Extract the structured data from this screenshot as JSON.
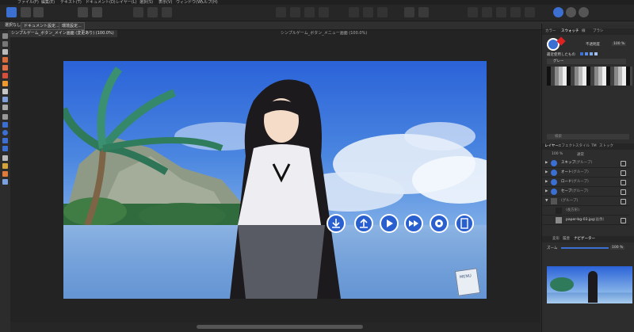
{
  "menubar": {
    "items": [
      "ファイル(F)",
      "編集(E)",
      "テキスト(T)",
      "ドキュメント(D)",
      "レイヤー(L)",
      "選択(S)",
      "表示(V)",
      "ウィンドウ(W)",
      "ヘルプ(H)"
    ]
  },
  "context_toolbar": {
    "deselect_label": "選択なし",
    "document_setup_label": "ドキュメント設定...",
    "preferences_label": "環境設定..."
  },
  "tabs": [
    {
      "label": "シンプルゲーム_ボタン_メイン画面 (変更あり) (100.0%)",
      "active": true
    },
    {
      "label": "シンプルゲーム_ボタン_メニュー画面 (100.0%)",
      "active": false
    }
  ],
  "right_panel": {
    "top_tabs": [
      "カラー",
      "スウォッチ",
      "線",
      "ブラシ"
    ],
    "active_top_tab": "スウォッチ",
    "opacity_label": "不透明度",
    "opacity_value": "100 %",
    "recent_label": "最近使用したもの",
    "palette_name": "グレー",
    "search_placeholder": "検索",
    "layer_tabs": [
      "レイヤー",
      "エフェクト",
      "スタイル",
      "TM",
      "ストック"
    ],
    "active_layer_tab": "レイヤー",
    "opacity_field": "100 %",
    "blend_mode": "通常",
    "layers": [
      {
        "name": "スキップ",
        "type": "(グループ)",
        "icon": "skip-icon"
      },
      {
        "name": "オート",
        "type": "(グループ)",
        "icon": "auto-icon"
      },
      {
        "name": "ロード",
        "type": "(グループ)",
        "icon": "load-icon"
      },
      {
        "name": "セーブ",
        "type": "(グループ)",
        "icon": "save-icon"
      },
      {
        "name": "",
        "type": "(グループ)",
        "icon": "group-icon"
      },
      {
        "name": "",
        "type": "(長方形)",
        "icon": "rectangle-icon"
      },
      {
        "name": "paper-bg-03.jpg",
        "type": "(画像)",
        "icon": "image-icon"
      }
    ],
    "nav_tabs": [
      "変形",
      "履歴",
      "ナビゲーター"
    ],
    "active_nav_tab": "ナビゲーター",
    "zoom_label": "ズーム",
    "zoom_value": "100 %"
  },
  "document": {
    "menu_label": "MENU"
  },
  "colors": {
    "accent": "#3b6fd1",
    "button_blue": "#2a5fd0",
    "sky_top": "#2b63d8",
    "sky_bottom": "#a9cdf0"
  }
}
